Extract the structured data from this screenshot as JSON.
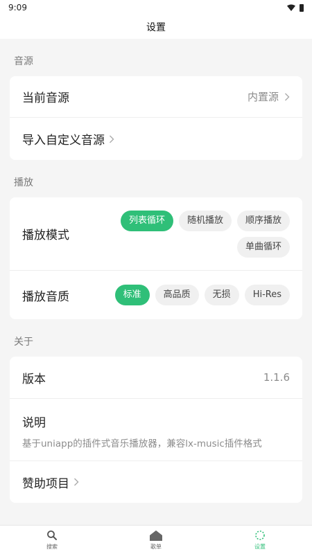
{
  "status_bar": {
    "time": "9:09"
  },
  "header": {
    "title": "设置"
  },
  "sections": {
    "source": {
      "title": "音源",
      "current_source_label": "当前音源",
      "current_source_value": "内置源",
      "import_label": "导入自定义音源"
    },
    "playback": {
      "title": "播放",
      "mode_label": "播放模式",
      "mode_options": [
        "列表循环",
        "随机播放",
        "顺序播放",
        "单曲循环"
      ],
      "mode_selected": "列表循环",
      "quality_label": "播放音质",
      "quality_options": [
        "标准",
        "高品质",
        "无损",
        "Hi-Res"
      ],
      "quality_selected": "标准"
    },
    "about": {
      "title": "关于",
      "version_label": "版本",
      "version_value": "1.1.6",
      "desc_label": "说明",
      "desc_text": "基于uniapp的插件式音乐播放器，兼容lx-music插件格式",
      "sponsor_label": "赞助项目"
    }
  },
  "tabbar": {
    "items": [
      {
        "label": "搜索",
        "icon": "search-icon"
      },
      {
        "label": "歌单",
        "icon": "home-icon"
      },
      {
        "label": "设置",
        "icon": "settings-icon",
        "active": true
      }
    ]
  },
  "colors": {
    "accent": "#2fbf78",
    "background": "#f5f5f5",
    "card": "#ffffff"
  }
}
